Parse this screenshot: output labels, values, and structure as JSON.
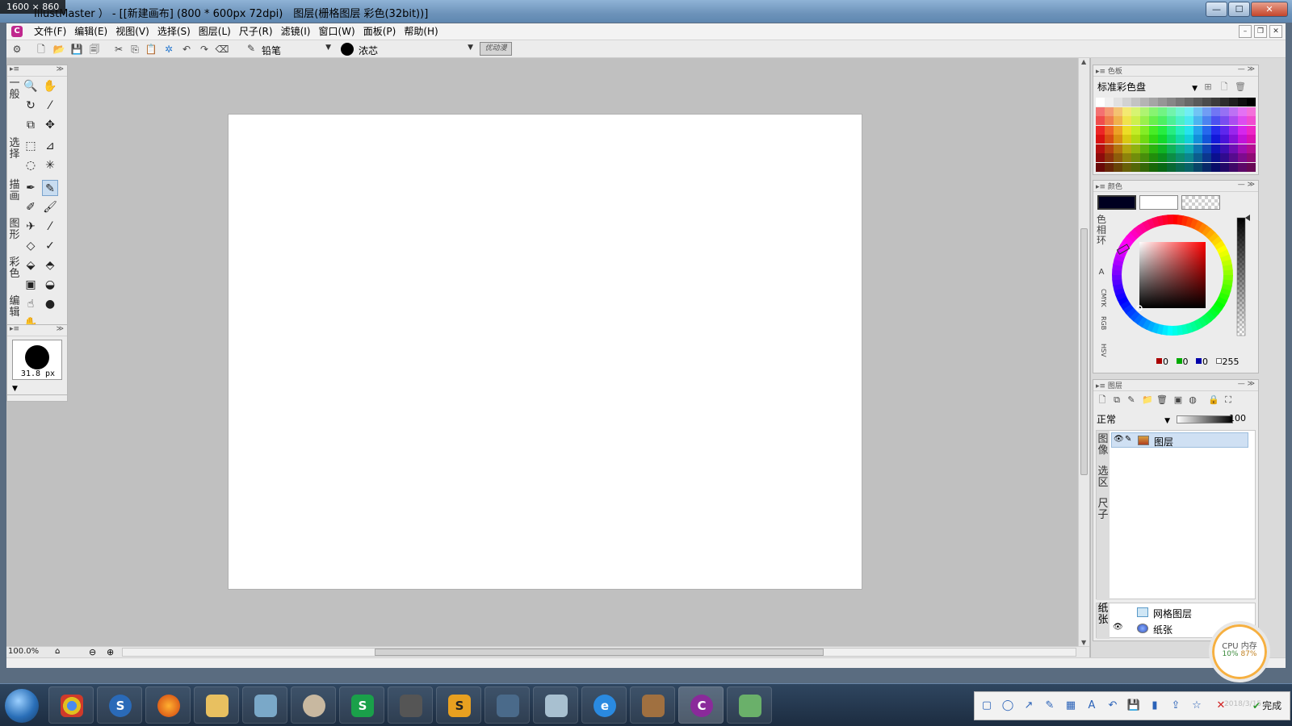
{
  "window": {
    "size_badge": "1600 × 860",
    "title": "IllustMaster ） - [[新建画布] (800 * 600px 72dpi)　图层(栅格图层 彩色(32bit))]",
    "controls": {
      "minimize": "—",
      "maximize": "☐",
      "close": "✕"
    }
  },
  "menu": {
    "logo": "C",
    "items": [
      "文件(F)",
      "编辑(E)",
      "视图(V)",
      "选择(S)",
      "图层(L)",
      "尺子(R)",
      "滤镜(I)",
      "窗口(W)",
      "面板(P)",
      "帮助(H)"
    ],
    "mdi": {
      "minimize": "–",
      "restore": "❐",
      "close": "✕"
    }
  },
  "toolbar": {
    "tool_name": "铅笔",
    "ink_name": "浓芯",
    "extra_label": "优动漫"
  },
  "tools": {
    "groups": [
      {
        "label": "一般"
      },
      {
        "label": "选择"
      },
      {
        "label": "描画"
      },
      {
        "label": "图形"
      },
      {
        "label": "彩色"
      },
      {
        "label": "编辑"
      }
    ],
    "brush_size": "31.8 px"
  },
  "canvas": {
    "zoom": "100.0%"
  },
  "palette": {
    "title": "色板",
    "selected": "标准彩色盘"
  },
  "color": {
    "title": "颜色",
    "tabs": [
      "色相环",
      "A",
      "CMYK",
      "RGB",
      "HSV"
    ],
    "rgb": {
      "r": "0",
      "g": "0",
      "b": "0",
      "a": "255"
    },
    "main_color": "#000020"
  },
  "layers": {
    "title": "图层",
    "blend_mode": "正常",
    "opacity": "100",
    "side_tabs": [
      "图像",
      "选区",
      "尺子"
    ],
    "paper_tab": "纸张",
    "items": [
      {
        "name": "图层",
        "selected": true
      },
      {
        "name": "网格图层",
        "selected": false
      },
      {
        "name": "纸张",
        "selected": false
      }
    ]
  },
  "system": {
    "cpu_label": "CPU 内存",
    "cpu_value": "10%",
    "mem_value": "87%",
    "done_label": "完成",
    "clock": "2018/3/15"
  }
}
